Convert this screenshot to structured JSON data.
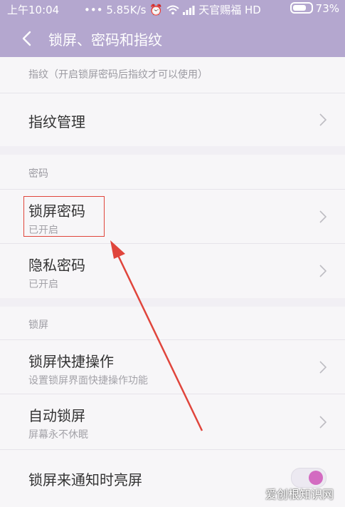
{
  "status_bar": {
    "time": "上午10:04",
    "speed": "5.85K/s",
    "carrier": "天官赐福 HD",
    "battery": "73%",
    "dots": "•••"
  },
  "header": {
    "title": "锁屏、密码和指纹"
  },
  "sections": {
    "fingerprint": {
      "header": "指纹（开启锁屏密码后指纹才可以使用）",
      "items": [
        {
          "label": "指纹管理"
        }
      ]
    },
    "password": {
      "header": "密码",
      "items": [
        {
          "label": "锁屏密码",
          "sub": "已开启"
        },
        {
          "label": "隐私密码",
          "sub": "已开启"
        }
      ]
    },
    "lockscreen": {
      "header": "锁屏",
      "items": [
        {
          "label": "锁屏快捷操作",
          "sub": "设置锁屏界面快捷操作功能"
        },
        {
          "label": "自动锁屏",
          "sub": "屏幕永不休眠"
        },
        {
          "label": "锁屏来通知时亮屏",
          "toggle": true
        }
      ]
    }
  },
  "watermark": "爱创根知识网",
  "colors": {
    "header_bg": "#b4a7cf",
    "annotation": "#e0453c",
    "toggle_knob": "#d36bc1"
  }
}
